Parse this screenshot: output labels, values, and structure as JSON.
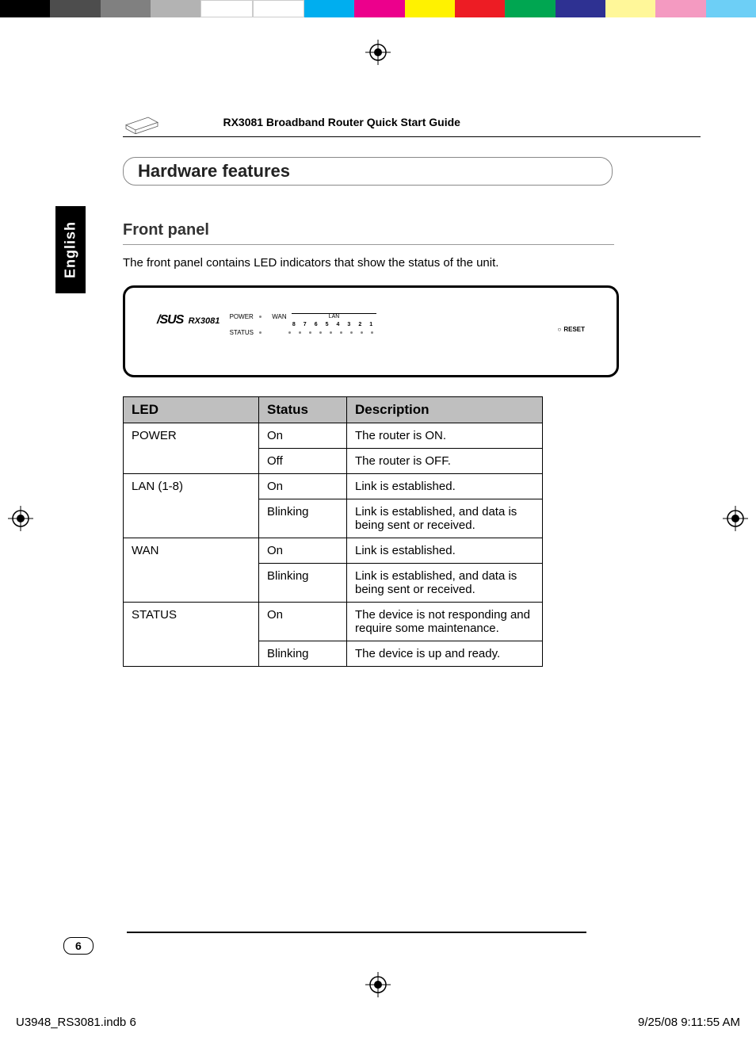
{
  "header": {
    "doc_title": "RX3081 Broadband Router Quick Start Guide"
  },
  "section": {
    "title": "Hardware features"
  },
  "side_tab": "English",
  "front_panel": {
    "heading": "Front panel",
    "body": "The front panel contains LED indicators that show the status of the unit."
  },
  "diagram": {
    "brand": "/SUS",
    "model": "RX3081",
    "power": "POWER",
    "status": "STATUS",
    "wan": "WAN",
    "lan": "LAN",
    "lan_ports": [
      "8",
      "7",
      "6",
      "5",
      "4",
      "3",
      "2",
      "1"
    ],
    "reset": "RESET"
  },
  "table": {
    "headers": {
      "led": "LED",
      "status": "Status",
      "desc": "Description"
    },
    "rows": [
      {
        "led": "POWER",
        "status": "On",
        "desc": "The router is ON."
      },
      {
        "led": "",
        "status": "Off",
        "desc": "The router is OFF."
      },
      {
        "led": "LAN (1-8)",
        "status": "On",
        "desc": "Link is established."
      },
      {
        "led": "",
        "status": "Blinking",
        "desc": "Link is established, and data is being sent or received."
      },
      {
        "led": "WAN",
        "status": "On",
        "desc": "Link is established."
      },
      {
        "led": "",
        "status": "Blinking",
        "desc": "Link is established, and data is being sent or received."
      },
      {
        "led": "STATUS",
        "status": "On",
        "desc": "The device is not responding and require some maintenance."
      },
      {
        "led": "",
        "status": "Blinking",
        "desc": "The device is up and ready."
      }
    ]
  },
  "page_number": "6",
  "footer": {
    "left": "U3948_RS3081.indb   6",
    "right": "9/25/08   9:11:55 AM"
  }
}
